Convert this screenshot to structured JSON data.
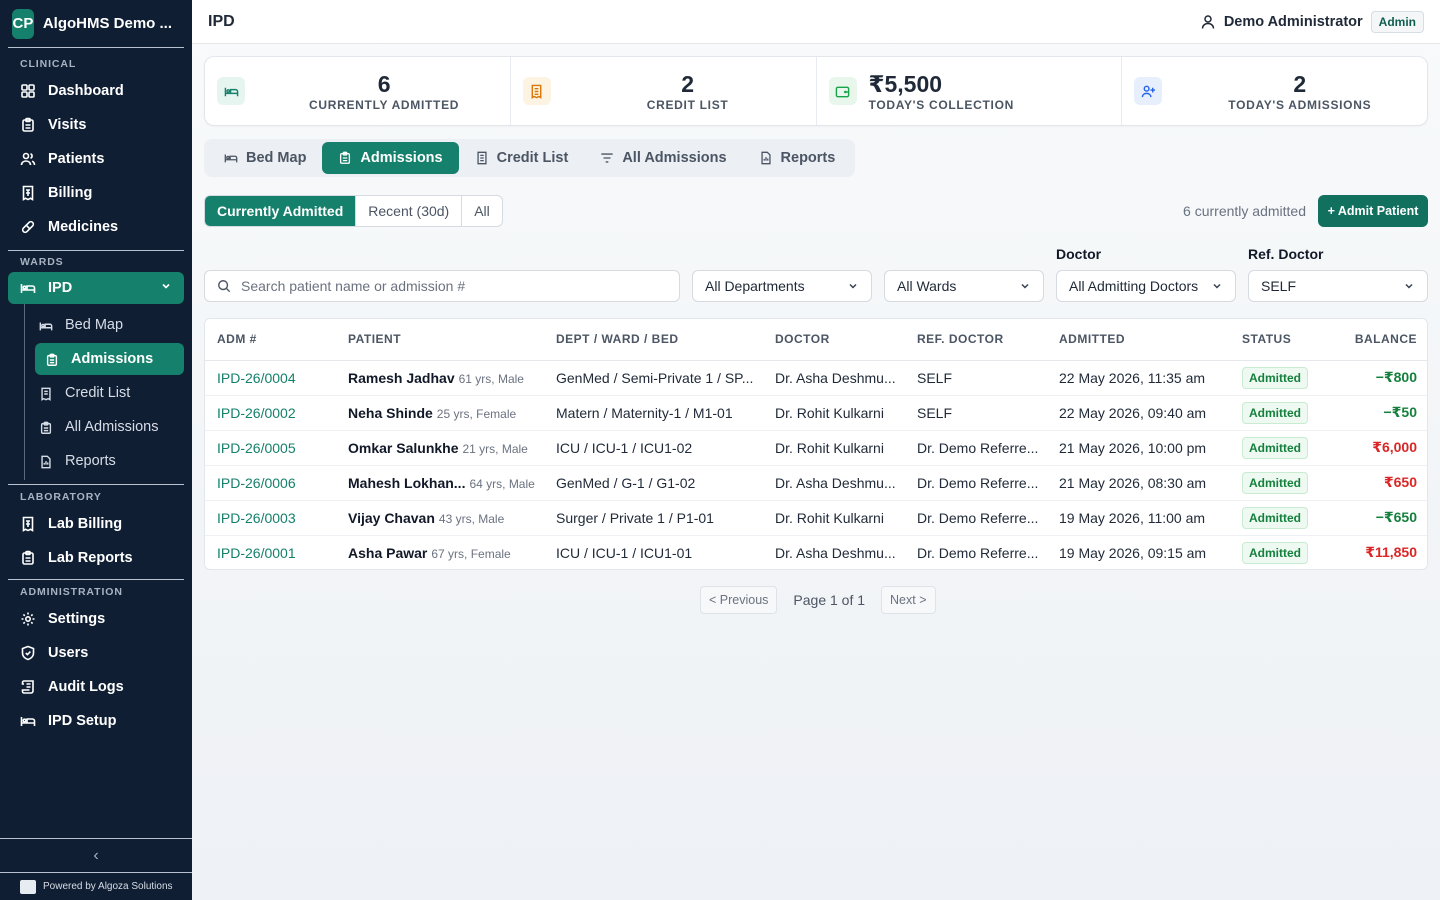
{
  "brand": {
    "logo": "CP",
    "name": "AlgoHMS Demo ..."
  },
  "sidebar": {
    "sections": {
      "clinical": "CLINICAL",
      "wards": "WARDS",
      "laboratory": "LABORATORY",
      "administration": "ADMINISTRATION"
    },
    "clinical_items": [
      {
        "label": "Dashboard",
        "icon": "dashboard-icon"
      },
      {
        "label": "Visits",
        "icon": "clipboard-icon"
      },
      {
        "label": "Patients",
        "icon": "users-icon"
      },
      {
        "label": "Billing",
        "icon": "receipt-icon"
      },
      {
        "label": "Medicines",
        "icon": "pill-icon"
      }
    ],
    "ipd": {
      "label": "IPD",
      "icon": "bed-icon"
    },
    "ipd_sub": [
      {
        "label": "Bed Map",
        "icon": "bed-icon"
      },
      {
        "label": "Admissions",
        "icon": "clipboard-icon"
      },
      {
        "label": "Credit List",
        "icon": "receipt-icon"
      },
      {
        "label": "All Admissions",
        "icon": "clipboard-icon"
      },
      {
        "label": "Reports",
        "icon": "report-icon"
      }
    ],
    "lab_items": [
      {
        "label": "Lab Billing",
        "icon": "receipt-icon"
      },
      {
        "label": "Lab Reports",
        "icon": "clipboard-icon"
      }
    ],
    "admin_items": [
      {
        "label": "Settings",
        "icon": "gear-icon"
      },
      {
        "label": "Users",
        "icon": "shield-icon"
      },
      {
        "label": "Audit Logs",
        "icon": "scroll-icon"
      },
      {
        "label": "IPD Setup",
        "icon": "bed-icon"
      }
    ],
    "collapse": "‹",
    "powered": "Powered by Algoza Solutions"
  },
  "topbar": {
    "title": "IPD",
    "user": "Demo Administrator",
    "role": "Admin"
  },
  "stats": [
    {
      "value": "6",
      "label": "CURRENTLY ADMITTED",
      "icon": "bed-icon",
      "color": "#15806b",
      "bg": "#e7f5f1"
    },
    {
      "value": "2",
      "label": "CREDIT LIST",
      "icon": "receipt-icon",
      "color": "#d97706",
      "bg": "#fdf3e3"
    },
    {
      "value": "₹5,500",
      "label": "TODAY'S COLLECTION",
      "icon": "wallet-icon",
      "color": "#16a34a",
      "bg": "#e8f6ec"
    },
    {
      "value": "2",
      "label": "TODAY'S ADMISSIONS",
      "icon": "user-plus-icon",
      "color": "#2563eb",
      "bg": "#e8effc"
    }
  ],
  "tabs": [
    {
      "label": "Bed Map"
    },
    {
      "label": "Admissions"
    },
    {
      "label": "Credit List"
    },
    {
      "label": "All Admissions"
    },
    {
      "label": "Reports"
    }
  ],
  "segments": [
    "Currently Admitted",
    "Recent (30d)",
    "All"
  ],
  "count_text": "6 currently admitted",
  "admit_button": "+ Admit Patient",
  "filters": {
    "search_placeholder": "Search patient name or admission #",
    "department": "All Departments",
    "ward": "All Wards",
    "doctor_label": "Doctor",
    "doctor": "All Admitting Doctors",
    "ref_label": "Ref. Doctor",
    "ref": "SELF"
  },
  "table": {
    "headers": [
      "ADM #",
      "PATIENT",
      "DEPT / WARD / BED",
      "DOCTOR",
      "REF. DOCTOR",
      "ADMITTED",
      "STATUS",
      "BALANCE"
    ],
    "rows": [
      {
        "adm": "IPD-26/0004",
        "name": "Ramesh Jadhav",
        "meta": "61 yrs, Male",
        "dept": "GenMed / Semi-Private 1 / SP...",
        "doctor": "Dr. Asha Deshmu...",
        "ref": "SELF",
        "admitted": "22 May 2026, 11:35 am",
        "status": "Admitted",
        "balance": "−₹800",
        "kind": "credit"
      },
      {
        "adm": "IPD-26/0002",
        "name": "Neha Shinde",
        "meta": "25 yrs, Female",
        "dept": "Matern / Maternity-1 / M1-01",
        "doctor": "Dr. Rohit Kulkarni",
        "ref": "SELF",
        "admitted": "22 May 2026, 09:40 am",
        "status": "Admitted",
        "balance": "−₹50",
        "kind": "credit"
      },
      {
        "adm": "IPD-26/0005",
        "name": "Omkar Salunkhe",
        "meta": "21 yrs, Male",
        "dept": "ICU / ICU-1 / ICU1-02",
        "doctor": "Dr. Rohit Kulkarni",
        "ref": "Dr. Demo Referre...",
        "admitted": "21 May 2026, 10:00 pm",
        "status": "Admitted",
        "balance": "₹6,000",
        "kind": "debit"
      },
      {
        "adm": "IPD-26/0006",
        "name": "Mahesh Lokhan...",
        "meta": "64 yrs, Male",
        "dept": "GenMed / G-1 / G1-02",
        "doctor": "Dr. Asha Deshmu...",
        "ref": "Dr. Demo Referre...",
        "admitted": "21 May 2026, 08:30 am",
        "status": "Admitted",
        "balance": "₹650",
        "kind": "debit"
      },
      {
        "adm": "IPD-26/0003",
        "name": "Vijay Chavan",
        "meta": "43 yrs, Male",
        "dept": "Surger / Private 1 / P1-01",
        "doctor": "Dr. Rohit Kulkarni",
        "ref": "Dr. Demo Referre...",
        "admitted": "19 May 2026, 11:00 am",
        "status": "Admitted",
        "balance": "−₹650",
        "kind": "credit"
      },
      {
        "adm": "IPD-26/0001",
        "name": "Asha Pawar",
        "meta": "67 yrs, Female",
        "dept": "ICU / ICU-1 / ICU1-01",
        "doctor": "Dr. Asha Deshmu...",
        "ref": "Dr. Demo Referre...",
        "admitted": "19 May 2026, 09:15 am",
        "status": "Admitted",
        "balance": "₹11,850",
        "kind": "debit"
      }
    ]
  },
  "pager": {
    "prev": "< Previous",
    "page": "Page 1 of 1",
    "next": "Next >"
  }
}
